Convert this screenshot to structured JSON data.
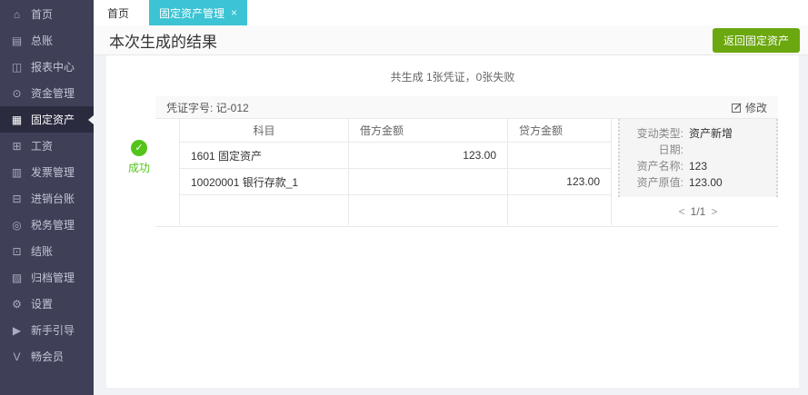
{
  "sidebar": {
    "items": [
      {
        "name": "home",
        "label": "首页",
        "icon": "⌂"
      },
      {
        "name": "general-ledger",
        "label": "总账",
        "icon": "▤"
      },
      {
        "name": "report-center",
        "label": "报表中心",
        "icon": "◫"
      },
      {
        "name": "funds-mgmt",
        "label": "资金管理",
        "icon": "⊙"
      },
      {
        "name": "fixed-assets",
        "label": "固定资产",
        "icon": "▦"
      },
      {
        "name": "payroll",
        "label": "工资",
        "icon": "⊞"
      },
      {
        "name": "invoice-mgmt",
        "label": "发票管理",
        "icon": "▥"
      },
      {
        "name": "purchase-sales",
        "label": "进销台账",
        "icon": "⊟"
      },
      {
        "name": "tax-mgmt",
        "label": "税务管理",
        "icon": "◎"
      },
      {
        "name": "closing",
        "label": "结账",
        "icon": "⊡"
      },
      {
        "name": "archive-mgmt",
        "label": "归档管理",
        "icon": "▨"
      },
      {
        "name": "settings",
        "label": "设置",
        "icon": "⚙"
      },
      {
        "name": "beginner-guide",
        "label": "新手引导",
        "icon": "▶"
      },
      {
        "name": "member",
        "label": "畅会员",
        "icon": "V"
      }
    ]
  },
  "tabs": {
    "home": {
      "label": "首页"
    },
    "active": {
      "label": "固定资产管理",
      "close": "×"
    }
  },
  "header": {
    "title": "本次生成的结果",
    "back_button": "返回固定资产"
  },
  "summary": "共生成 1张凭证，0张失败",
  "voucher": {
    "number_label": "凭证字号: 记-012",
    "edit_label": "修改",
    "status": "成功",
    "status_check": "✓",
    "table": {
      "headers": [
        "科目",
        "借方金额",
        "贷方金额"
      ],
      "rows": [
        [
          "1601 固定资产",
          "123.00",
          ""
        ],
        [
          "10020001 银行存款_1",
          "",
          "123.00"
        ]
      ]
    },
    "details": [
      {
        "label": "变动类型:",
        "value": "资产新增"
      },
      {
        "label": "日期:",
        "value": ""
      },
      {
        "label": "资产名称:",
        "value": "123"
      },
      {
        "label": "资产原值:",
        "value": "123.00"
      }
    ],
    "pagination": {
      "prev": "<",
      "current": "1/1",
      "next": ">"
    }
  },
  "colors": {
    "sidebar_bg": "#3f3f58",
    "sidebar_active_bg": "#2b2b40",
    "active_tab": "#3cc3d4",
    "back_button_green": "#6ba70e",
    "success_green": "#52c41a"
  }
}
